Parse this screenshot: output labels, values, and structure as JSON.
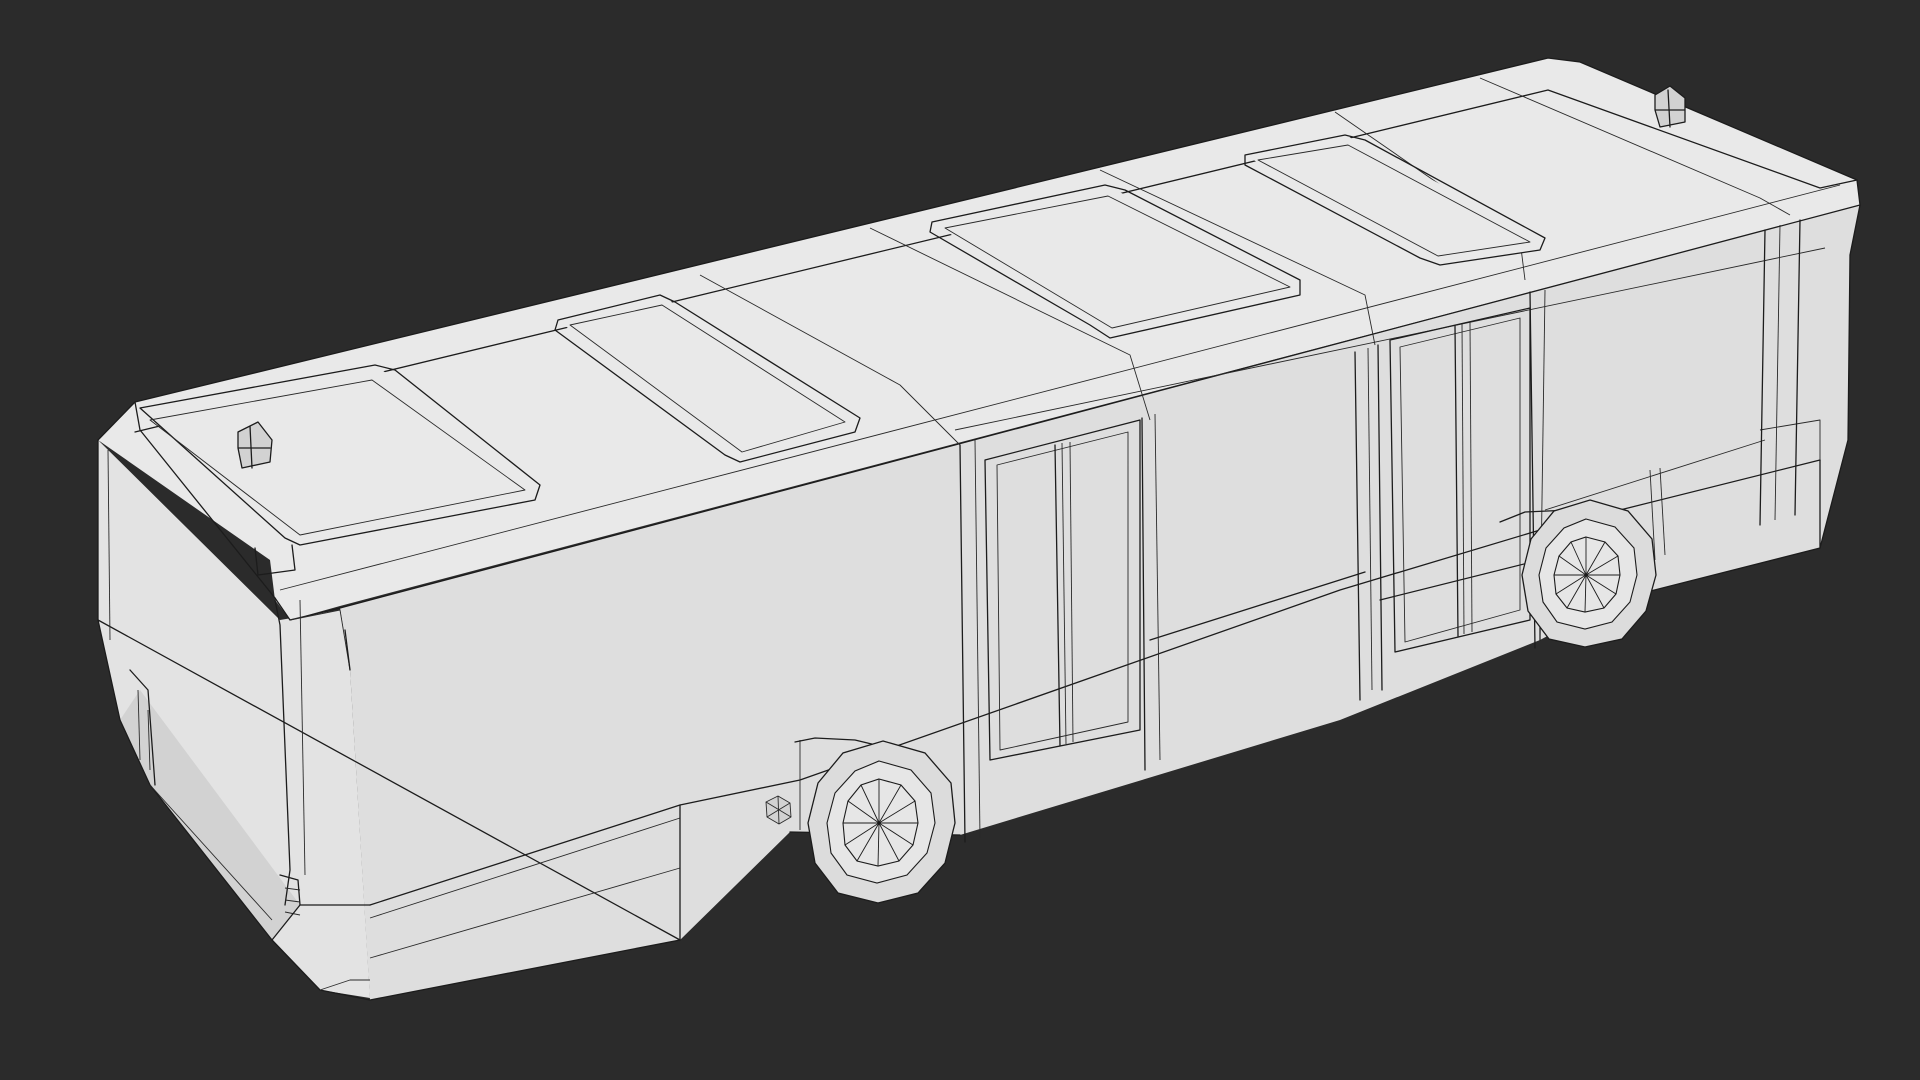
{
  "scene": {
    "background": "#2b2b2b",
    "model": "bus",
    "render_style": "clay-wireframe",
    "model_color": "#e6e6e6",
    "wire_color": "#1c1c1c"
  }
}
